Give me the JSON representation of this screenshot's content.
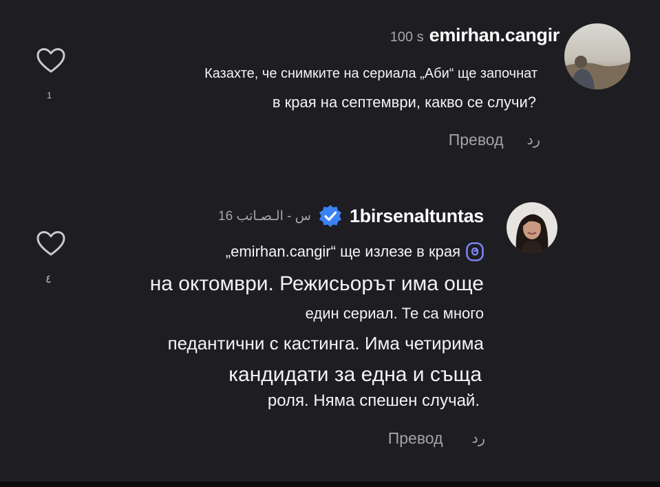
{
  "comments": [
    {
      "time": "100 s",
      "username": "emirhan.cangir",
      "text_lines": [
        "Казахте, че снимките на сериала „Аби“ ще започнат",
        "в края на септември, какво се случи?"
      ],
      "likes": "1",
      "translate_label": "Превод",
      "reply_label": "رد"
    },
    {
      "time": "16 س - الـصـاتب",
      "username": "1birsenaltuntas",
      "verified": true,
      "text_lines": [
        "„emirhan.cangir“ ще излезе в края",
        "на октомври. Режисьорът има още",
        "един сериал. Те са много",
        "педантични с кастинга. Има четирима",
        "кандидати за една и съща",
        "роля. Няма спешен случай."
      ],
      "likes": "٤",
      "translate_label": "Превод",
      "reply_label": "رد"
    }
  ],
  "colors": {
    "background": "#1d1d22",
    "verified_badge": "#3b82f6",
    "muted_text": "#a6a6ad"
  },
  "icons": [
    "heart-icon",
    "verified-badge-icon",
    "threads-icon"
  ]
}
